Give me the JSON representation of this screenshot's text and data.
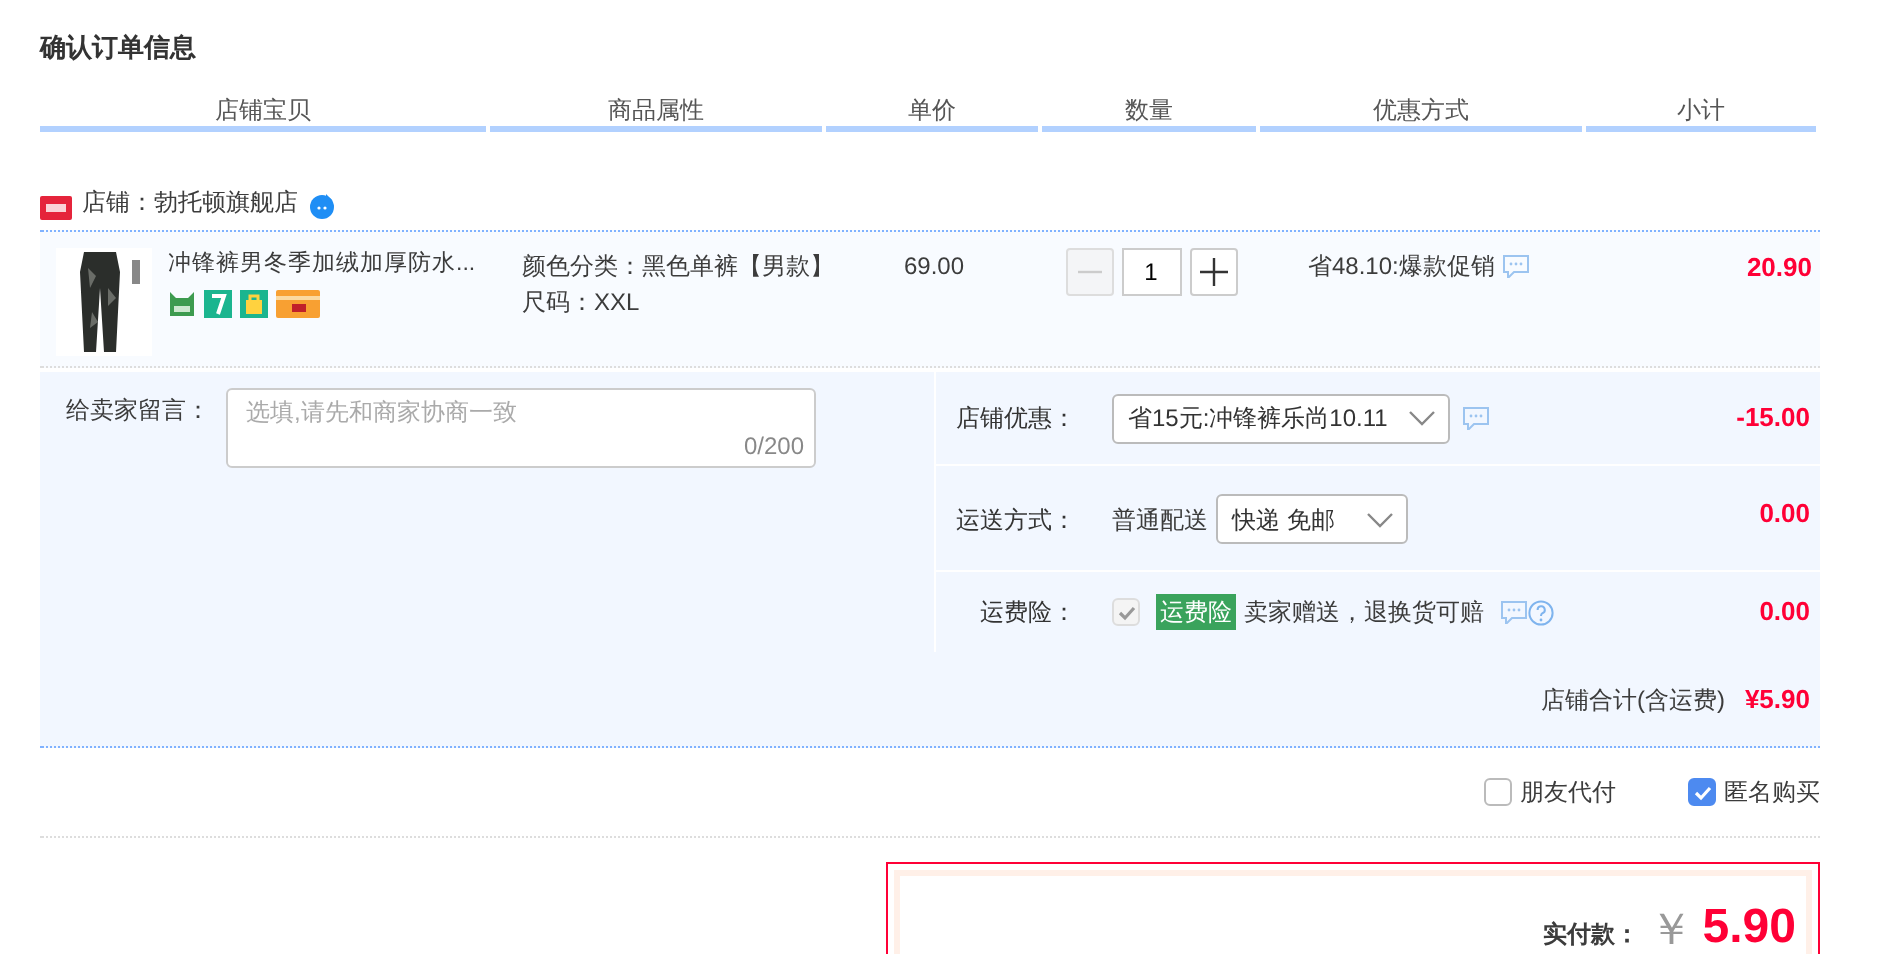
{
  "title": "确认订单信息",
  "columns": [
    "店铺宝贝",
    "商品属性",
    "单价",
    "数量",
    "优惠方式",
    "小计"
  ],
  "shop": {
    "name": "店铺：勃托顿旗舰店"
  },
  "item": {
    "title": "冲锋裤男冬季加绒加厚防水...",
    "attributes": [
      "颜色分类：黑色单裤【男款】",
      "尺码：XXL"
    ],
    "price": "69.00",
    "quantity": "1",
    "discount": "省48.10:爆款促销",
    "subtotal": "20.90"
  },
  "message": {
    "label": "给卖家留言：",
    "placeholder": "选填,请先和商家协商一致",
    "counter": "0/200"
  },
  "shop_discount": {
    "label": "店铺优惠：",
    "value": "省15元:冲锋裤乐尚10.11",
    "amount": "-15.00"
  },
  "delivery": {
    "label": "运送方式：",
    "method": "普通配送",
    "value": "快递 免邮",
    "amount": "0.00"
  },
  "insurance": {
    "label": "运费险：",
    "checked": true,
    "disabled": true,
    "badge": "运费险",
    "text": "卖家赠送，退换货可赔",
    "amount": "0.00"
  },
  "shop_total": {
    "label": "店铺合计(含运费)",
    "amount": "¥5.90"
  },
  "options": [
    {
      "label": "朋友代付",
      "checked": false
    },
    {
      "label": "匿名购买",
      "checked": true
    }
  ],
  "payment": {
    "label": "实付款：",
    "currency": "￥",
    "amount": "5.90"
  }
}
